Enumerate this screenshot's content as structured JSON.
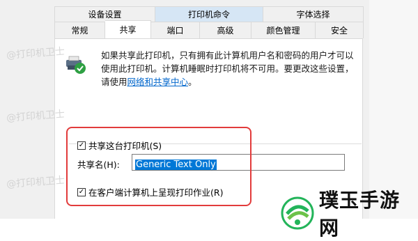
{
  "tabs": {
    "top": [
      {
        "label": "设备设置"
      },
      {
        "label": "打印机命令"
      },
      {
        "label": "字体选择"
      }
    ],
    "bottom": [
      {
        "label": "常规"
      },
      {
        "label": "共享"
      },
      {
        "label": "端口"
      },
      {
        "label": "高级"
      },
      {
        "label": "颜色管理"
      },
      {
        "label": "安全"
      }
    ]
  },
  "info": {
    "text": "如果共享此打印机，只有拥有此计算机用户名和密码的用户才可以使用此打印机。计算机睡眠时打印机将不可用。要更改这些设置，请使用",
    "link_text": "网络和共享中心",
    "suffix": "。"
  },
  "share": {
    "share_checkbox_label": "共享这台打印机(S)",
    "share_name_label": "共享名(H):",
    "share_name_value": "Generic  Text Only",
    "render_checkbox_label": "在客户端计算机上呈现打印作业(R)"
  },
  "watermarks": [
    "@打印机卫士",
    "@打印机卫士",
    "@打印机卫士"
  ],
  "logo": {
    "text": "璞玉手游网"
  },
  "colors": {
    "accent": "#0078d7",
    "highlight_box": "#e23b3b",
    "logo_green": "#23b45a"
  }
}
